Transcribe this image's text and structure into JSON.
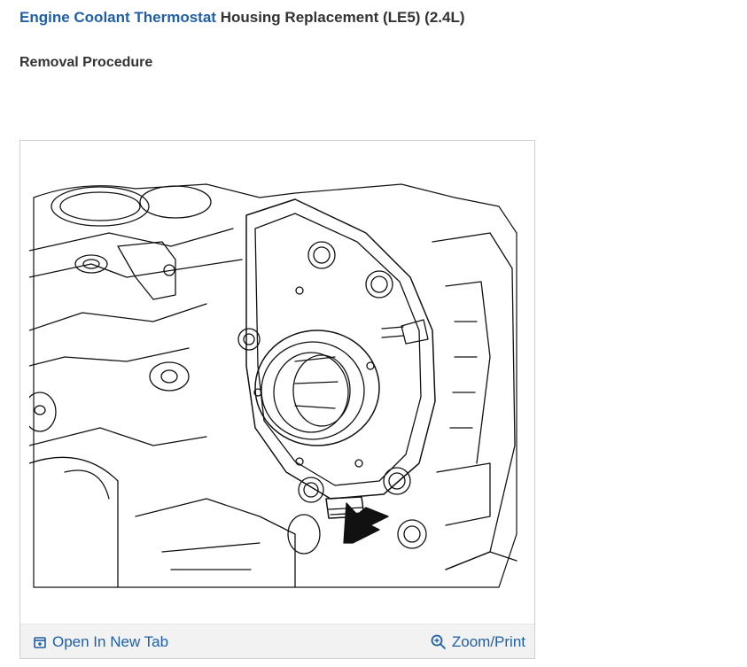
{
  "header": {
    "title_link": "Engine Coolant Thermostat",
    "title_rest": "Housing Replacement (LE5) (2.4L)"
  },
  "section": {
    "heading": "Removal Procedure"
  },
  "figure": {
    "open_tab_label": "Open In New Tab",
    "zoom_label": "Zoom/Print",
    "open_tab_icon": "open-in-new-tab-icon",
    "zoom_icon": "magnifier-icon"
  },
  "colors": {
    "link": "#1f5fa8",
    "text": "#333333",
    "border": "#cfcfcf",
    "bar": "#f2f2f2"
  }
}
